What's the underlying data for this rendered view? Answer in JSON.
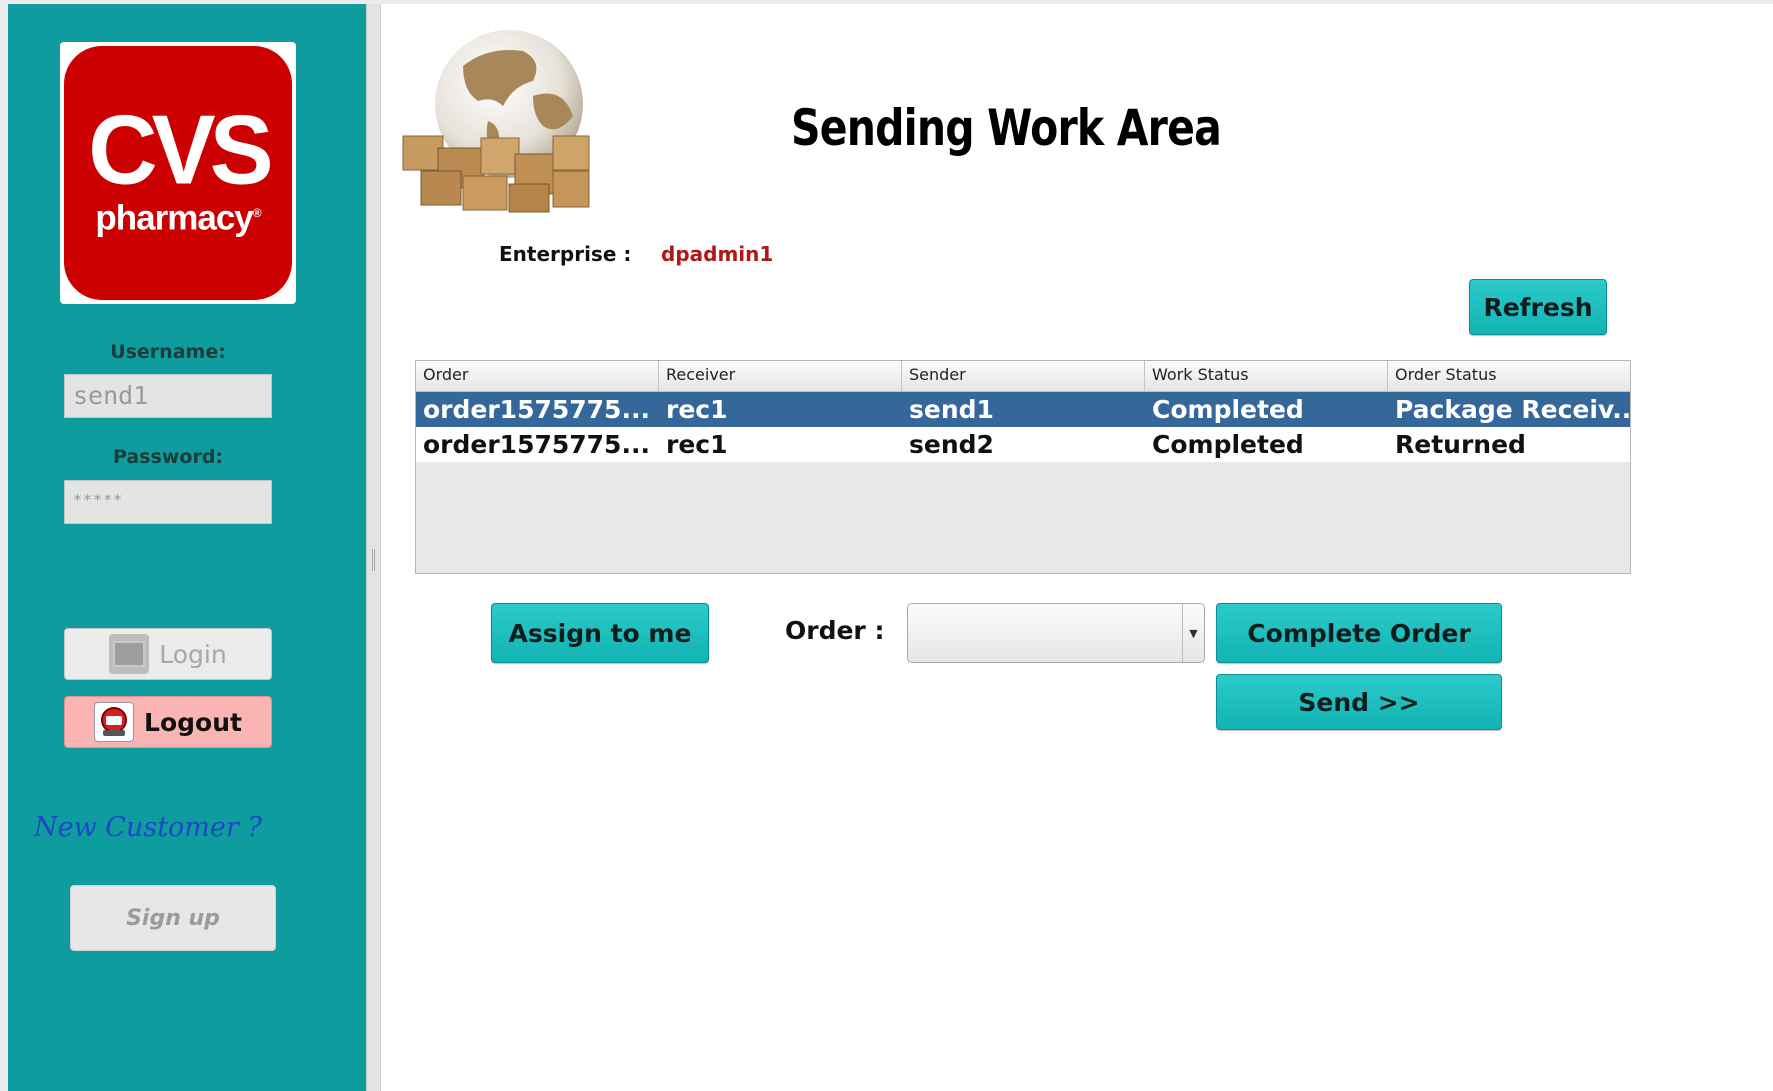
{
  "sidebar": {
    "logo": {
      "line1": "CVS",
      "line2": "pharmacy",
      "registered_mark": "®"
    },
    "username_label": "Username:",
    "username_value": "send1",
    "password_label": "Password:",
    "password_value": "*****",
    "login_label": "Login",
    "logout_label": "Logout",
    "new_customer_text": "New Customer ?",
    "signup_label": "Sign up"
  },
  "header": {
    "title": "Sending Work Area",
    "enterprise_label": "Enterprise :",
    "enterprise_value": "dpadmin1"
  },
  "toolbar": {
    "refresh_label": "Refresh"
  },
  "table": {
    "columns": [
      "Order",
      "Receiver",
      "Sender",
      "Work Status",
      "Order Status"
    ],
    "rows": [
      [
        "order1575775...",
        "rec1",
        "send1",
        "Completed",
        "Package Receiv..."
      ],
      [
        "order1575775...",
        "rec1",
        "send2",
        "Completed",
        "Returned"
      ]
    ],
    "selected_row": 0
  },
  "actions": {
    "assign_label": "Assign to me",
    "order_label": "Order :",
    "order_select_value": "",
    "complete_label": "Complete Order",
    "send_label": "Send >>"
  },
  "colors": {
    "sidebar": "#0e9c9e",
    "accent_button": "#1bbcbd",
    "logout_button": "#fbb4b4",
    "selected_row": "#36679b",
    "enterprise_value": "#b01818",
    "link": "#1e46c8",
    "logo_red": "#cc0000"
  },
  "icons": {
    "login": "login-icon",
    "logout": "logout-icon",
    "globe": "globe-packages-icon",
    "dropdown": "chevron-down-icon"
  }
}
